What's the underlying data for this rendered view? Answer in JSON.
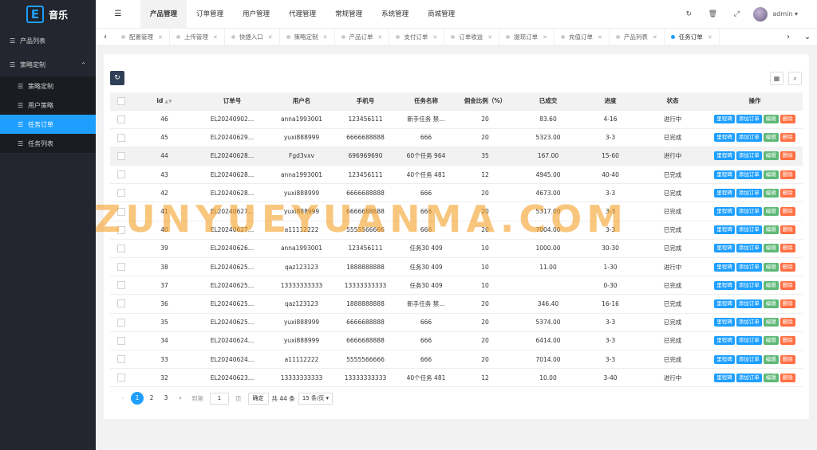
{
  "brand": {
    "logo_letter": "E",
    "title": "音乐"
  },
  "sidebar": {
    "items": [
      {
        "label": "产品列表",
        "icon": "list-icon"
      },
      {
        "label": "策略定制",
        "icon": "list-icon",
        "expanded": true,
        "children": [
          {
            "label": "策略定制",
            "icon": "list-icon"
          },
          {
            "label": "用户策略",
            "icon": "list-icon"
          },
          {
            "label": "任务订单",
            "icon": "list-icon",
            "active": true
          },
          {
            "label": "任务列表",
            "icon": "list-icon"
          }
        ]
      }
    ]
  },
  "header": {
    "menu": [
      "产品管理",
      "订单管理",
      "用户管理",
      "代理管理",
      "常规管理",
      "系统管理",
      "商城管理"
    ],
    "active_menu": "产品管理",
    "admin": "admin"
  },
  "tabs": [
    "配置管理",
    "上传管理",
    "快捷入口",
    "策略定制",
    "产品订单",
    "支付订单",
    "订单收益",
    "提现订单",
    "充值订单",
    "产品列表",
    "任务订单"
  ],
  "active_tab": "任务订单",
  "table": {
    "columns": [
      "id",
      "订单号",
      "用户名",
      "手机号",
      "任务名称",
      "佣金比例（%）",
      "已成交",
      "进度",
      "状态",
      "操作"
    ],
    "rows": [
      {
        "id": "46",
        "order": "EL20240902…",
        "user": "anna1993001",
        "phone": "123456111",
        "task": "新手任务 禁…",
        "rate": "20",
        "done": "83.60",
        "progress": "4-16",
        "status": "进行中"
      },
      {
        "id": "45",
        "order": "EL20240629…",
        "user": "yuxi888999",
        "phone": "6666688888",
        "task": "666",
        "rate": "20",
        "done": "5323.00",
        "progress": "3-3",
        "status": "已完成"
      },
      {
        "id": "44",
        "order": "EL20240628…",
        "user": "Fgd3vxv",
        "phone": "696969690",
        "task": "60个任务 964",
        "rate": "35",
        "done": "167.00",
        "progress": "15-60",
        "status": "进行中"
      },
      {
        "id": "43",
        "order": "EL20240628…",
        "user": "anna1993001",
        "phone": "123456111",
        "task": "40个任务 481",
        "rate": "12",
        "done": "4945.00",
        "progress": "40-40",
        "status": "已完成"
      },
      {
        "id": "42",
        "order": "EL20240628…",
        "user": "yuxi888999",
        "phone": "6666688888",
        "task": "666",
        "rate": "20",
        "done": "4673.00",
        "progress": "3-3",
        "status": "已完成"
      },
      {
        "id": "41",
        "order": "EL20240627…",
        "user": "yuxi888999",
        "phone": "6666688888",
        "task": "666",
        "rate": "20",
        "done": "5317.00",
        "progress": "3-3",
        "status": "已完成"
      },
      {
        "id": "40",
        "order": "EL20240627…",
        "user": "a11112222",
        "phone": "5555566666",
        "task": "666",
        "rate": "20",
        "done": "7004.00",
        "progress": "3-3",
        "status": "已完成"
      },
      {
        "id": "39",
        "order": "EL20240626…",
        "user": "anna1993001",
        "phone": "123456111",
        "task": "任务30 409",
        "rate": "10",
        "done": "1000.00",
        "progress": "30-30",
        "status": "已完成"
      },
      {
        "id": "38",
        "order": "EL20240625…",
        "user": "qaz123123",
        "phone": "1888888888",
        "task": "任务30 409",
        "rate": "10",
        "done": "11.00",
        "progress": "1-30",
        "status": "进行中"
      },
      {
        "id": "37",
        "order": "EL20240625…",
        "user": "13333333333",
        "phone": "13333333333",
        "task": "任务30 409",
        "rate": "10",
        "done": "",
        "progress": "0-30",
        "status": "已完成"
      },
      {
        "id": "36",
        "order": "EL20240625…",
        "user": "qaz123123",
        "phone": "1888888888",
        "task": "新手任务 禁…",
        "rate": "20",
        "done": "346.40",
        "progress": "16-16",
        "status": "已完成"
      },
      {
        "id": "35",
        "order": "EL20240625…",
        "user": "yuxi888999",
        "phone": "6666688888",
        "task": "666",
        "rate": "20",
        "done": "5374.00",
        "progress": "3-3",
        "status": "已完成"
      },
      {
        "id": "34",
        "order": "EL20240624…",
        "user": "yuxi888999",
        "phone": "6666688888",
        "task": "666",
        "rate": "20",
        "done": "6414.00",
        "progress": "3-3",
        "status": "已完成"
      },
      {
        "id": "33",
        "order": "EL20240624…",
        "user": "a11112222",
        "phone": "5555566666",
        "task": "666",
        "rate": "20",
        "done": "7014.00",
        "progress": "3-3",
        "status": "已完成"
      },
      {
        "id": "32",
        "order": "EL20240623…",
        "user": "13333333333",
        "phone": "13333333333",
        "task": "40个任务 481",
        "rate": "12",
        "done": "10.00",
        "progress": "3-40",
        "status": "进行中"
      }
    ],
    "actions": {
      "milestone": "里程碑",
      "add_order": "添加订单",
      "edit": "编辑",
      "delete": "删除"
    }
  },
  "pagination": {
    "prev": "‹",
    "next": "›",
    "pages": [
      "1",
      "2",
      "3"
    ],
    "current": "1",
    "goto_label": "到第",
    "goto_value": "1",
    "page_unit": "页",
    "confirm": "确定",
    "total": "共 44 条",
    "page_size": "15 条/页"
  },
  "watermark": "ZUNYUEYUANMA.COM",
  "colors": {
    "primary": "#1e9fff",
    "sidebar": "#23262e",
    "green": "#5fb878",
    "red": "#ff5722"
  }
}
